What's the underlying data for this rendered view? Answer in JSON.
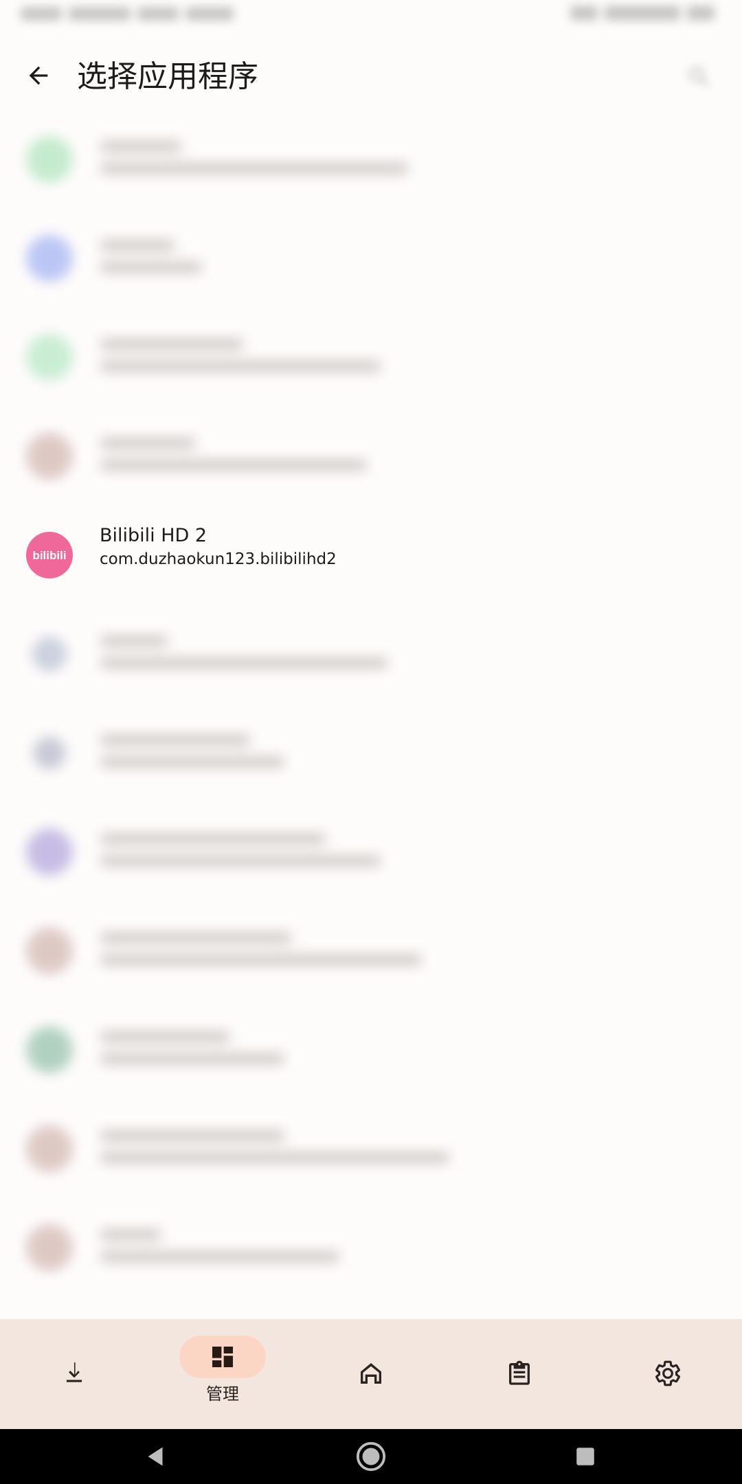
{
  "app_bar": {
    "title": "选择应用程序",
    "back_icon": "arrow-back-icon",
    "search_icon": "search-icon"
  },
  "apps": [
    {
      "icon_color": "#9fe0b0",
      "blurred": true
    },
    {
      "icon_color": "#8fa3f0",
      "blurred": true
    },
    {
      "icon_color": "#a6e3b8",
      "blurred": true
    },
    {
      "icon_color": "#c8a8a0",
      "blurred": true
    },
    {
      "name": "Bilibili HD 2",
      "package": "com.duzhaokun123.bilibilihd2",
      "icon_color": "#f0679a",
      "icon_text": "bilibili",
      "blurred": false
    },
    {
      "icon_color": "#aab4cc",
      "blurred": true
    },
    {
      "icon_color": "#a3a8c0",
      "blurred": true
    },
    {
      "icon_color": "#a293d6",
      "blurred": true
    },
    {
      "icon_color": "#c8a8a0",
      "blurred": true
    },
    {
      "icon_color": "#7fb59a",
      "blurred": true
    },
    {
      "icon_color": "#c8a8a0",
      "blurred": true
    },
    {
      "icon_color": "#c8a8a0",
      "blurred": true
    }
  ],
  "bottom_nav": {
    "items": [
      {
        "icon": "download-icon",
        "label": ""
      },
      {
        "icon": "dashboard-icon",
        "label": "管理",
        "active": true
      },
      {
        "icon": "home-icon",
        "label": ""
      },
      {
        "icon": "clipboard-icon",
        "label": ""
      },
      {
        "icon": "settings-icon",
        "label": ""
      }
    ],
    "background": "#f3e6df",
    "active_pill": "#fbd6c5"
  },
  "system_nav": {
    "buttons": [
      "back-triangle-icon",
      "home-circle-icon",
      "recents-square-icon"
    ]
  }
}
